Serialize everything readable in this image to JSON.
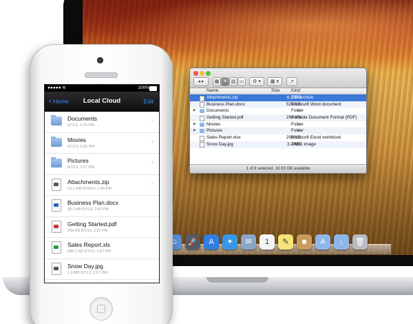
{
  "desktop": {
    "finder": {
      "toolbar_action_glyph": "⚙ ▾",
      "toolbar_arrange_glyph": "▦ ▾",
      "toolbar_share_glyph": "↗",
      "columns": {
        "name": "Name",
        "size": "Size",
        "kind": "Kind"
      },
      "rows": [
        {
          "name": "Attachments.zip",
          "size": "6.3 MB",
          "kind": "ZIP archive",
          "icon": "zip-file-icon",
          "selected": true,
          "expandable": false
        },
        {
          "name": "Business Plan.docx",
          "size": "521 KB",
          "kind": "Microsoft Word document",
          "icon": "document-icon",
          "selected": false,
          "expandable": false
        },
        {
          "name": "Documents",
          "size": "--",
          "kind": "Folder",
          "icon": "folder-icon",
          "selected": false,
          "expandable": true
        },
        {
          "name": "Getting Started.pdf",
          "size": "299 KB",
          "kind": "Portable Document Format (PDF)",
          "icon": "pdf-file-icon",
          "selected": false,
          "expandable": false
        },
        {
          "name": "Movies",
          "size": "--",
          "kind": "Folder",
          "icon": "folder-icon",
          "selected": false,
          "expandable": true
        },
        {
          "name": "Pictures",
          "size": "--",
          "kind": "Folder",
          "icon": "folder-icon",
          "selected": false,
          "expandable": true
        },
        {
          "name": "Sales Report.xlsx",
          "size": "292 KB",
          "kind": "Microsoft Excel workbook",
          "icon": "spreadsheet-icon",
          "selected": false,
          "expandable": false
        },
        {
          "name": "Snow Day.jpg",
          "size": "3.2 MB",
          "kind": "JPEG image",
          "icon": "image-file-icon",
          "selected": false,
          "expandable": false
        }
      ],
      "status": "1 of 8 selected, 16.93 GB available",
      "selection_color": "#3b78d8"
    },
    "dock_icons": [
      {
        "name": "finder-dock-icon",
        "color": "#5a8fd6",
        "glyph": "☺"
      },
      {
        "name": "launchpad-dock-icon",
        "color": "#555a66",
        "glyph": "🚀"
      },
      {
        "name": "app-store-dock-icon",
        "color": "#2f7fe0",
        "glyph": "A"
      },
      {
        "name": "safari-dock-icon",
        "color": "#3a97e8",
        "glyph": "✦"
      },
      {
        "name": "mail-dock-icon",
        "color": "#8aa7c8",
        "glyph": "✉"
      },
      {
        "name": "calendar-dock-icon",
        "color": "#f4f4f4",
        "glyph": "1"
      },
      {
        "name": "notes-dock-icon",
        "color": "#f5e27a",
        "glyph": "✎"
      },
      {
        "name": "contacts-dock-icon",
        "color": "#c99b5e",
        "glyph": "☻"
      },
      {
        "name": "applications-folder-dock-icon",
        "color": "#8fb6e8",
        "glyph": "A"
      },
      {
        "name": "downloads-folder-dock-icon",
        "color": "#8fb6e8",
        "glyph": "↓"
      },
      {
        "name": "trash-dock-icon",
        "color": "#b9bcc0",
        "glyph": "🗑"
      }
    ]
  },
  "phone": {
    "status": {
      "left": "●●●●● ≋",
      "battery": "100%"
    },
    "nav": {
      "back": "Home",
      "title": "Local Cloud",
      "edit": "Edit"
    },
    "items": [
      {
        "name": "Documents",
        "meta": "6/7/13, 2:35 PM",
        "type": "folder",
        "chevron": true
      },
      {
        "name": "Movies",
        "meta": "6/7/13, 2:35 PM",
        "type": "folder",
        "chevron": true
      },
      {
        "name": "Pictures",
        "meta": "6/7/13, 2:57 PM",
        "type": "folder",
        "chevron": true
      },
      {
        "name": "Attachments.zip",
        "meta": "13.2 MB 6/29/13, 1:58 PM",
        "type": "zip",
        "chevron": true
      },
      {
        "name": "Business Plan.docx",
        "meta": "30.2 KB 6/7/13, 2:02 PM",
        "type": "docx",
        "chevron": false
      },
      {
        "name": "Getting Started.pdf",
        "meta": "299 KB 6/7/13, 2:57 PM",
        "type": "pdf",
        "chevron": false
      },
      {
        "name": "Sales Report.xls",
        "meta": "835.1 KB 6/7/13, 2:57 PM",
        "type": "xls",
        "chevron": false
      },
      {
        "name": "Snow Day.jpg",
        "meta": "1.9 MB 6/7/13, 2:57 PM",
        "type": "jpg",
        "chevron": false
      }
    ],
    "tint_color": "#3b8cf5"
  }
}
